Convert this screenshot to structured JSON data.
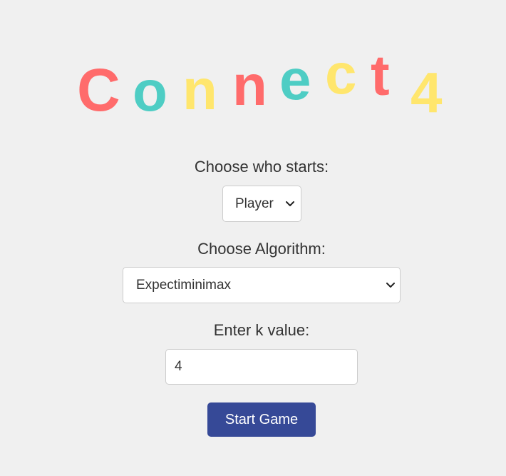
{
  "title": {
    "letters": [
      {
        "char": "C",
        "color": "#ff6b6b"
      },
      {
        "char": "o",
        "color": "#4ecdc4"
      },
      {
        "char": "n",
        "color": "#ffe66d"
      },
      {
        "char": "n",
        "color": "#ff6b6b"
      },
      {
        "char": "e",
        "color": "#4ecdc4"
      },
      {
        "char": "c",
        "color": "#ffe66d"
      },
      {
        "char": "t",
        "color": "#ff6b6b"
      },
      {
        "char": "4",
        "color": "#ffe66d"
      }
    ]
  },
  "starter": {
    "label": "Choose who starts:",
    "selected": "Player"
  },
  "algorithm": {
    "label": "Choose Algorithm:",
    "selected": "Expectiminimax"
  },
  "k_value": {
    "label": "Enter k value:",
    "value": "4"
  },
  "start_button": {
    "label": "Start Game"
  },
  "colors": {
    "background": "#f0f0f0",
    "button": "#364997"
  },
  "icons": {
    "dropdown": "chevron-down-icon"
  }
}
